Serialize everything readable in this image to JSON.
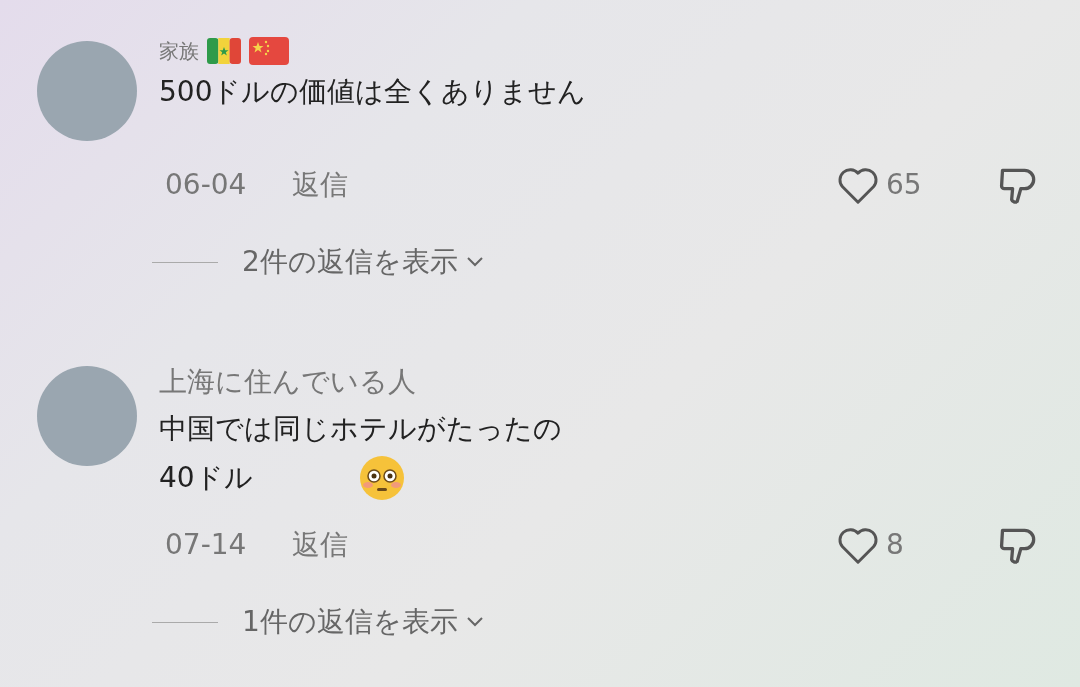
{
  "comments": [
    {
      "username": "家族",
      "badges": [
        {
          "kind": "flag_sn"
        },
        {
          "kind": "flag_cn"
        }
      ],
      "lines": [
        {
          "text": "500ドルの価値は全くありません",
          "emoji": false
        }
      ],
      "date": "06-04",
      "reply": "返信",
      "likes": "65",
      "liked": false,
      "view_replies": "2件の返信を表示"
    },
    {
      "username": "上海に住んでいる人",
      "lines": [
        {
          "text": "中国では同じホテルがたったの",
          "emoji": false
        },
        {
          "text": "40ドル",
          "emoji": true
        }
      ],
      "date": "07-14",
      "reply": "返信",
      "likes": "8",
      "liked": false,
      "view_replies": "1件の返信を表示"
    }
  ]
}
